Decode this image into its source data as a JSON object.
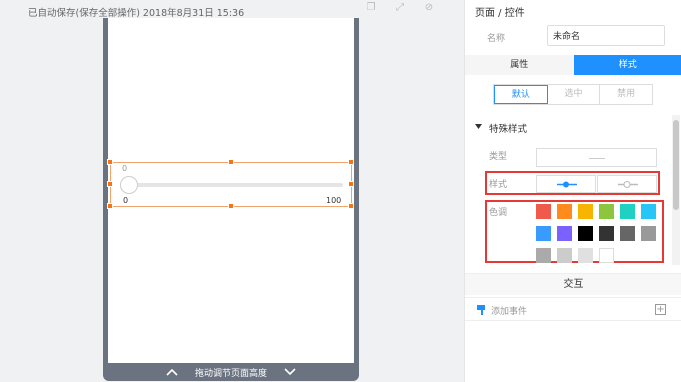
{
  "header": {
    "autosave_text": "已自动保存(保存全部操作) 2018年8月31日 15:36"
  },
  "canvas": {
    "slider": {
      "value_label": "0",
      "min_label": "0",
      "max_label": "100"
    },
    "footer_label": "拖动调节页面高度"
  },
  "panel": {
    "breadcrumb": "页面 / 控件",
    "name_label": "名称",
    "name_value": "未命名",
    "tabs": {
      "properties": "属性",
      "style": "样式"
    },
    "states": {
      "default": "默认",
      "selected": "选中",
      "disabled": "禁用"
    },
    "section_title": "特殊样式",
    "type_label": "类型",
    "style_label": "样式",
    "color_label": "色调",
    "swatches": [
      "#f05a4a",
      "#ff8a1e",
      "#f7b500",
      "#8cc63f",
      "#1fd1c1",
      "#26c6f7",
      "#3a9bff",
      "#7b61ff",
      "#000000",
      "#333333",
      "#666666",
      "#999999",
      "#aaaaaa",
      "#cccccc",
      "#e0e0e0",
      "#ffffff"
    ],
    "interaction_title": "交互",
    "add_event_label": "添加事件"
  },
  "colors": {
    "accent": "#1e90ff",
    "selection": "#f97316",
    "highlight": "#e53935"
  }
}
